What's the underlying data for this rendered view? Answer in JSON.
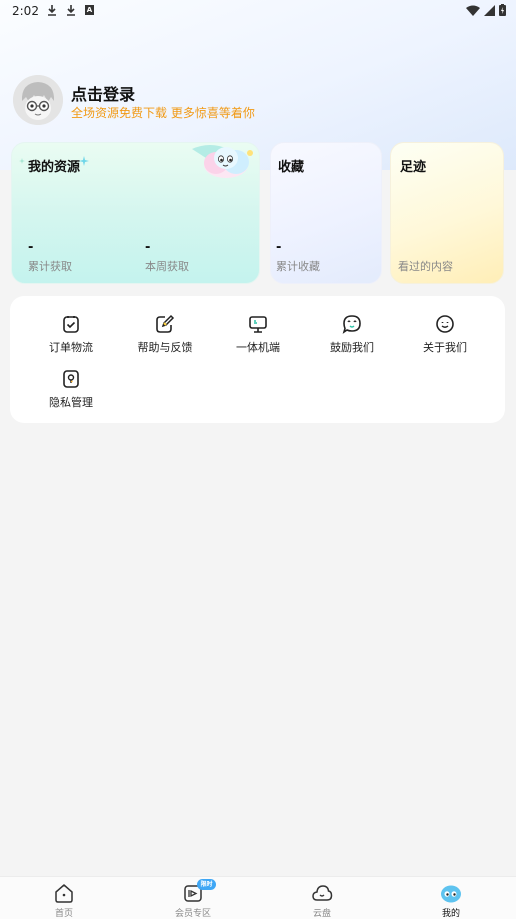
{
  "status_bar": {
    "time": "2:02",
    "notification_letter": "A"
  },
  "profile": {
    "title": "点击登录",
    "subtitle": "全场资源免费下载 更多惊喜等着你"
  },
  "cards": {
    "resources": {
      "title": "我的资源",
      "stat1_value": "-",
      "stat1_label": "累计获取",
      "stat2_value": "-",
      "stat2_label": "本周获取"
    },
    "favorites": {
      "title": "收藏",
      "value": "-",
      "label": "累计收藏"
    },
    "footprints": {
      "title": "足迹",
      "label": "看过的内容"
    }
  },
  "menu": {
    "items": [
      {
        "label": "订单物流",
        "icon": "order-icon"
      },
      {
        "label": "帮助与反馈",
        "icon": "edit-icon"
      },
      {
        "label": "一体机端",
        "icon": "monitor-icon"
      },
      {
        "label": "鼓励我们",
        "icon": "chat-icon"
      },
      {
        "label": "关于我们",
        "icon": "smile-icon"
      },
      {
        "label": "隐私管理",
        "icon": "privacy-icon"
      }
    ]
  },
  "tabbar": {
    "items": [
      {
        "label": "首页",
        "icon": "home-icon"
      },
      {
        "label": "会员专区",
        "icon": "vip-icon",
        "badge": "限时"
      },
      {
        "label": "云盘",
        "icon": "cloud-icon"
      },
      {
        "label": "我的",
        "icon": "mine-icon",
        "active": true
      }
    ]
  },
  "colors": {
    "accent_orange": "#f19a16",
    "badge_blue": "#3fa7f5"
  }
}
